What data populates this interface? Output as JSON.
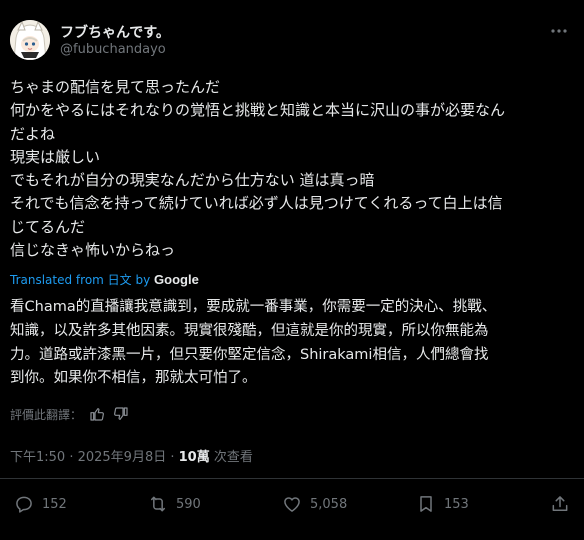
{
  "user": {
    "display_name": "フブちゃんです。",
    "handle": "@fubuchandayo",
    "avatar_icon": "fubuki-avatar-icon",
    "more_icon": "more-icon"
  },
  "post": {
    "lines": [
      "ちゃまの配信を見て思ったんだ",
      "何かをやるにはそれなりの覚悟と挑戦と知識と本当に沢山の事が必要なん",
      "だよね",
      "現実は厳しい",
      "でもそれが自分の現実なんだから仕方ない 道は真っ暗",
      "それでも信念を持って続けていれば必ず人は見つけてくれるって白上は信",
      "じてるんだ",
      "信じなきゃ怖いからねっ"
    ]
  },
  "translation": {
    "label": "Translated from 日文 by",
    "provider": "Google",
    "lines": [
      "看Chama的直播讓我意識到，要成就一番事業，你需要一定的決心、挑戰、",
      "知識，以及許多其他因素。現實很殘酷，但這就是你的現實，所以你無能為",
      "力。道路或許漆黑一片，但只要你堅定信念，Shirakami相信，人們總會找",
      "到你。如果你不相信，那就太可怕了。"
    ],
    "rate_label": "評價此翻譯："
  },
  "meta": {
    "time": "下午1:50 · 2025年9月8日 · ",
    "views_count": "10萬",
    "views_label": " 次查看"
  },
  "actions": {
    "replies": "152",
    "reposts": "590",
    "likes": "5,058",
    "bookmarks": "153"
  },
  "colors": {
    "background": "#000000",
    "text": "#e7e9ea",
    "muted": "#71767b",
    "link": "#1d9bf0",
    "divider": "#2f3336"
  }
}
